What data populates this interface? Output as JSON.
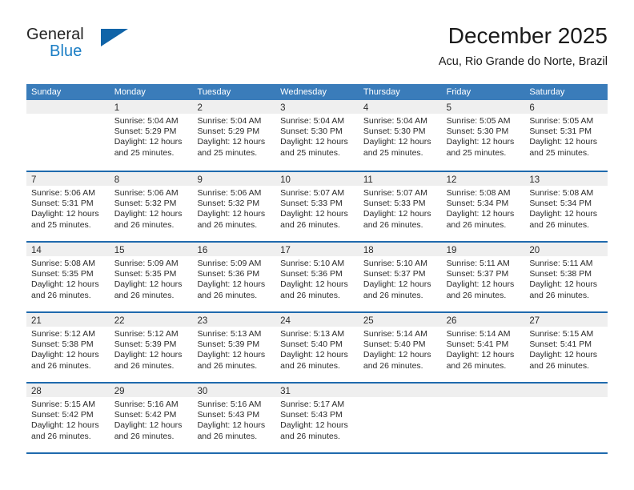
{
  "brand": {
    "name_part1": "General",
    "name_part2": "Blue",
    "triangle_icon": "triangle-icon",
    "accent_color": "#1064a8",
    "blue_text_color": "#1a7dc4"
  },
  "header": {
    "month_title": "December 2025",
    "location": "Acu, Rio Grande do Norte, Brazil"
  },
  "calendar": {
    "header_bg": "#3a7cba",
    "separator_color": "#1f6aad",
    "day_band_bg": "#efefef",
    "day_names": [
      "Sunday",
      "Monday",
      "Tuesday",
      "Wednesday",
      "Thursday",
      "Friday",
      "Saturday"
    ],
    "weeks": [
      [
        {
          "day": "",
          "empty": true,
          "sunrise": "",
          "sunset": "",
          "daylight1": "",
          "daylight2": ""
        },
        {
          "day": "1",
          "empty": false,
          "sunrise": "Sunrise: 5:04 AM",
          "sunset": "Sunset: 5:29 PM",
          "daylight1": "Daylight: 12 hours",
          "daylight2": "and 25 minutes."
        },
        {
          "day": "2",
          "empty": false,
          "sunrise": "Sunrise: 5:04 AM",
          "sunset": "Sunset: 5:29 PM",
          "daylight1": "Daylight: 12 hours",
          "daylight2": "and 25 minutes."
        },
        {
          "day": "3",
          "empty": false,
          "sunrise": "Sunrise: 5:04 AM",
          "sunset": "Sunset: 5:30 PM",
          "daylight1": "Daylight: 12 hours",
          "daylight2": "and 25 minutes."
        },
        {
          "day": "4",
          "empty": false,
          "sunrise": "Sunrise: 5:04 AM",
          "sunset": "Sunset: 5:30 PM",
          "daylight1": "Daylight: 12 hours",
          "daylight2": "and 25 minutes."
        },
        {
          "day": "5",
          "empty": false,
          "sunrise": "Sunrise: 5:05 AM",
          "sunset": "Sunset: 5:30 PM",
          "daylight1": "Daylight: 12 hours",
          "daylight2": "and 25 minutes."
        },
        {
          "day": "6",
          "empty": false,
          "sunrise": "Sunrise: 5:05 AM",
          "sunset": "Sunset: 5:31 PM",
          "daylight1": "Daylight: 12 hours",
          "daylight2": "and 25 minutes."
        }
      ],
      [
        {
          "day": "7",
          "empty": false,
          "sunrise": "Sunrise: 5:06 AM",
          "sunset": "Sunset: 5:31 PM",
          "daylight1": "Daylight: 12 hours",
          "daylight2": "and 25 minutes."
        },
        {
          "day": "8",
          "empty": false,
          "sunrise": "Sunrise: 5:06 AM",
          "sunset": "Sunset: 5:32 PM",
          "daylight1": "Daylight: 12 hours",
          "daylight2": "and 26 minutes."
        },
        {
          "day": "9",
          "empty": false,
          "sunrise": "Sunrise: 5:06 AM",
          "sunset": "Sunset: 5:32 PM",
          "daylight1": "Daylight: 12 hours",
          "daylight2": "and 26 minutes."
        },
        {
          "day": "10",
          "empty": false,
          "sunrise": "Sunrise: 5:07 AM",
          "sunset": "Sunset: 5:33 PM",
          "daylight1": "Daylight: 12 hours",
          "daylight2": "and 26 minutes."
        },
        {
          "day": "11",
          "empty": false,
          "sunrise": "Sunrise: 5:07 AM",
          "sunset": "Sunset: 5:33 PM",
          "daylight1": "Daylight: 12 hours",
          "daylight2": "and 26 minutes."
        },
        {
          "day": "12",
          "empty": false,
          "sunrise": "Sunrise: 5:08 AM",
          "sunset": "Sunset: 5:34 PM",
          "daylight1": "Daylight: 12 hours",
          "daylight2": "and 26 minutes."
        },
        {
          "day": "13",
          "empty": false,
          "sunrise": "Sunrise: 5:08 AM",
          "sunset": "Sunset: 5:34 PM",
          "daylight1": "Daylight: 12 hours",
          "daylight2": "and 26 minutes."
        }
      ],
      [
        {
          "day": "14",
          "empty": false,
          "sunrise": "Sunrise: 5:08 AM",
          "sunset": "Sunset: 5:35 PM",
          "daylight1": "Daylight: 12 hours",
          "daylight2": "and 26 minutes."
        },
        {
          "day": "15",
          "empty": false,
          "sunrise": "Sunrise: 5:09 AM",
          "sunset": "Sunset: 5:35 PM",
          "daylight1": "Daylight: 12 hours",
          "daylight2": "and 26 minutes."
        },
        {
          "day": "16",
          "empty": false,
          "sunrise": "Sunrise: 5:09 AM",
          "sunset": "Sunset: 5:36 PM",
          "daylight1": "Daylight: 12 hours",
          "daylight2": "and 26 minutes."
        },
        {
          "day": "17",
          "empty": false,
          "sunrise": "Sunrise: 5:10 AM",
          "sunset": "Sunset: 5:36 PM",
          "daylight1": "Daylight: 12 hours",
          "daylight2": "and 26 minutes."
        },
        {
          "day": "18",
          "empty": false,
          "sunrise": "Sunrise: 5:10 AM",
          "sunset": "Sunset: 5:37 PM",
          "daylight1": "Daylight: 12 hours",
          "daylight2": "and 26 minutes."
        },
        {
          "day": "19",
          "empty": false,
          "sunrise": "Sunrise: 5:11 AM",
          "sunset": "Sunset: 5:37 PM",
          "daylight1": "Daylight: 12 hours",
          "daylight2": "and 26 minutes."
        },
        {
          "day": "20",
          "empty": false,
          "sunrise": "Sunrise: 5:11 AM",
          "sunset": "Sunset: 5:38 PM",
          "daylight1": "Daylight: 12 hours",
          "daylight2": "and 26 minutes."
        }
      ],
      [
        {
          "day": "21",
          "empty": false,
          "sunrise": "Sunrise: 5:12 AM",
          "sunset": "Sunset: 5:38 PM",
          "daylight1": "Daylight: 12 hours",
          "daylight2": "and 26 minutes."
        },
        {
          "day": "22",
          "empty": false,
          "sunrise": "Sunrise: 5:12 AM",
          "sunset": "Sunset: 5:39 PM",
          "daylight1": "Daylight: 12 hours",
          "daylight2": "and 26 minutes."
        },
        {
          "day": "23",
          "empty": false,
          "sunrise": "Sunrise: 5:13 AM",
          "sunset": "Sunset: 5:39 PM",
          "daylight1": "Daylight: 12 hours",
          "daylight2": "and 26 minutes."
        },
        {
          "day": "24",
          "empty": false,
          "sunrise": "Sunrise: 5:13 AM",
          "sunset": "Sunset: 5:40 PM",
          "daylight1": "Daylight: 12 hours",
          "daylight2": "and 26 minutes."
        },
        {
          "day": "25",
          "empty": false,
          "sunrise": "Sunrise: 5:14 AM",
          "sunset": "Sunset: 5:40 PM",
          "daylight1": "Daylight: 12 hours",
          "daylight2": "and 26 minutes."
        },
        {
          "day": "26",
          "empty": false,
          "sunrise": "Sunrise: 5:14 AM",
          "sunset": "Sunset: 5:41 PM",
          "daylight1": "Daylight: 12 hours",
          "daylight2": "and 26 minutes."
        },
        {
          "day": "27",
          "empty": false,
          "sunrise": "Sunrise: 5:15 AM",
          "sunset": "Sunset: 5:41 PM",
          "daylight1": "Daylight: 12 hours",
          "daylight2": "and 26 minutes."
        }
      ],
      [
        {
          "day": "28",
          "empty": false,
          "sunrise": "Sunrise: 5:15 AM",
          "sunset": "Sunset: 5:42 PM",
          "daylight1": "Daylight: 12 hours",
          "daylight2": "and 26 minutes."
        },
        {
          "day": "29",
          "empty": false,
          "sunrise": "Sunrise: 5:16 AM",
          "sunset": "Sunset: 5:42 PM",
          "daylight1": "Daylight: 12 hours",
          "daylight2": "and 26 minutes."
        },
        {
          "day": "30",
          "empty": false,
          "sunrise": "Sunrise: 5:16 AM",
          "sunset": "Sunset: 5:43 PM",
          "daylight1": "Daylight: 12 hours",
          "daylight2": "and 26 minutes."
        },
        {
          "day": "31",
          "empty": false,
          "sunrise": "Sunrise: 5:17 AM",
          "sunset": "Sunset: 5:43 PM",
          "daylight1": "Daylight: 12 hours",
          "daylight2": "and 26 minutes."
        },
        {
          "day": "",
          "empty": true,
          "sunrise": "",
          "sunset": "",
          "daylight1": "",
          "daylight2": ""
        },
        {
          "day": "",
          "empty": true,
          "sunrise": "",
          "sunset": "",
          "daylight1": "",
          "daylight2": ""
        },
        {
          "day": "",
          "empty": true,
          "sunrise": "",
          "sunset": "",
          "daylight1": "",
          "daylight2": ""
        }
      ]
    ]
  }
}
